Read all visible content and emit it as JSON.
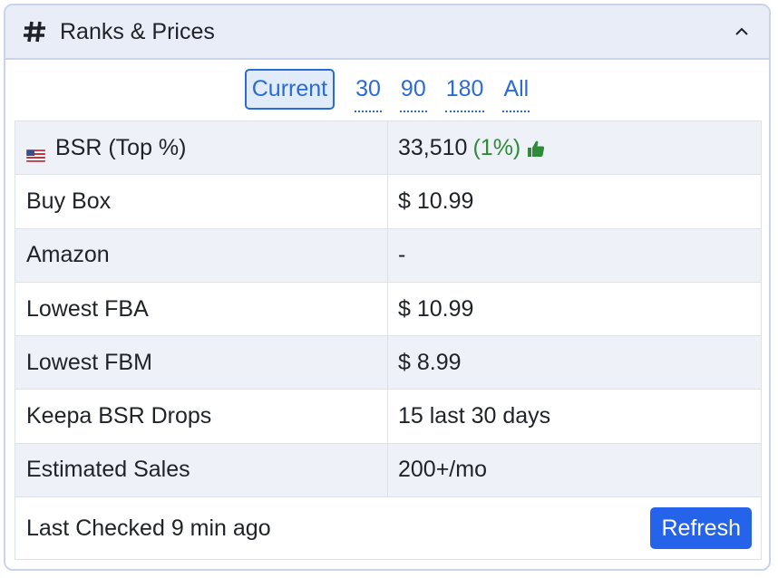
{
  "panel": {
    "title": "Ranks & Prices",
    "header_icon": "hash-icon",
    "collapse_icon": "chevron-up-icon"
  },
  "tabs": [
    {
      "label": "Current",
      "active": true
    },
    {
      "label": "30",
      "active": false
    },
    {
      "label": "90",
      "active": false
    },
    {
      "label": "180",
      "active": false
    },
    {
      "label": "All",
      "active": false
    }
  ],
  "rows": [
    {
      "label": "BSR (Top %)",
      "value": "33,510",
      "extra": "(1%)",
      "flag_icon": "us-flag-icon",
      "badge_icon": "thumbs-up-icon"
    },
    {
      "label": "Buy Box",
      "value": "$ 10.99"
    },
    {
      "label": "Amazon",
      "value": "-"
    },
    {
      "label": "Lowest FBA",
      "value": "$ 10.99"
    },
    {
      "label": "Lowest FBM",
      "value": "$ 8.99"
    },
    {
      "label": "Keepa BSR Drops",
      "value": "15 last 30 days"
    },
    {
      "label": "Estimated Sales",
      "value": "200+/mo"
    }
  ],
  "footer": {
    "last_checked": "Last Checked 9 min ago",
    "refresh_label": "Refresh"
  },
  "colors": {
    "accent": "#2563eb",
    "link": "#2a6bd6",
    "positive": "#2f8a3a",
    "header_bg": "#e8edf7",
    "row_shade": "#eef1f8"
  }
}
